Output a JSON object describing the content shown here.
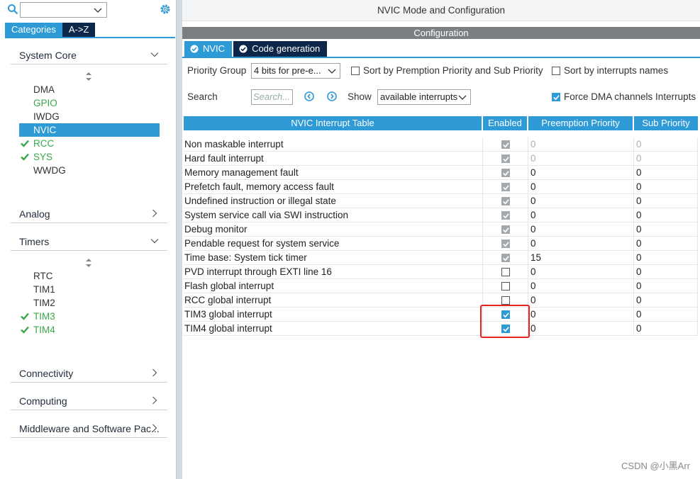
{
  "left_panel": {
    "search_value": "",
    "tabs": [
      {
        "label": "Categories",
        "active": true
      },
      {
        "label": "A->Z",
        "active": false
      }
    ],
    "categories": {
      "system_core": {
        "label": "System Core",
        "items": [
          {
            "label": "DMA",
            "state": "normal"
          },
          {
            "label": "GPIO",
            "state": "green"
          },
          {
            "label": "IWDG",
            "state": "normal"
          },
          {
            "label": "NVIC",
            "state": "selected"
          },
          {
            "label": "RCC",
            "state": "green-check"
          },
          {
            "label": "SYS",
            "state": "green-check"
          },
          {
            "label": "WWDG",
            "state": "normal"
          }
        ]
      },
      "analog": {
        "label": "Analog"
      },
      "timers": {
        "label": "Timers",
        "items": [
          {
            "label": "RTC",
            "state": "normal"
          },
          {
            "label": "TIM1",
            "state": "normal"
          },
          {
            "label": "TIM2",
            "state": "normal"
          },
          {
            "label": "TIM3",
            "state": "green-check"
          },
          {
            "label": "TIM4",
            "state": "green-check"
          }
        ]
      },
      "connectivity": {
        "label": "Connectivity"
      },
      "computing": {
        "label": "Computing"
      },
      "middleware": {
        "label": "Middleware and Software Pac..."
      }
    }
  },
  "right_panel": {
    "title": "NVIC Mode and Configuration",
    "config_label": "Configuration",
    "tabs": [
      {
        "label": "NVIC",
        "active": true
      },
      {
        "label": "Code generation",
        "active": false
      }
    ],
    "priority_group_label": "Priority Group",
    "priority_group_value": "4 bits for pre-e...",
    "sort_premption_label": "Sort by Premption Priority and Sub Priority",
    "sort_names_label": "Sort by interrupts names",
    "search_label": "Search",
    "search_placeholder": "Search...",
    "show_label": "Show",
    "show_value": "available interrupts",
    "force_dma_label": "Force DMA channels Interrupts",
    "table": {
      "headers": [
        "NVIC Interrupt Table",
        "Enabled",
        "Preemption Priority",
        "Sub Priority"
      ],
      "rows": [
        {
          "name": "Non maskable interrupt",
          "enabled": "locked",
          "preemption": "0",
          "sub": "0",
          "faded": true
        },
        {
          "name": "Hard fault interrupt",
          "enabled": "locked",
          "preemption": "0",
          "sub": "0",
          "faded": true
        },
        {
          "name": "Memory management fault",
          "enabled": "locked",
          "preemption": "0",
          "sub": "0",
          "faded": false
        },
        {
          "name": "Prefetch fault, memory access fault",
          "enabled": "locked",
          "preemption": "0",
          "sub": "0",
          "faded": false
        },
        {
          "name": "Undefined instruction or illegal state",
          "enabled": "locked",
          "preemption": "0",
          "sub": "0",
          "faded": false
        },
        {
          "name": "System service call via SWI instruction",
          "enabled": "locked",
          "preemption": "0",
          "sub": "0",
          "faded": false
        },
        {
          "name": "Debug monitor",
          "enabled": "locked",
          "preemption": "0",
          "sub": "0",
          "faded": false
        },
        {
          "name": "Pendable request for system service",
          "enabled": "locked",
          "preemption": "0",
          "sub": "0",
          "faded": false
        },
        {
          "name": "Time base: System tick timer",
          "enabled": "locked",
          "preemption": "15",
          "sub": "0",
          "faded": false
        },
        {
          "name": "PVD interrupt through EXTI line 16",
          "enabled": "off",
          "preemption": "0",
          "sub": "0",
          "faded": false
        },
        {
          "name": "Flash global interrupt",
          "enabled": "off",
          "preemption": "0",
          "sub": "0",
          "faded": false
        },
        {
          "name": "RCC global interrupt",
          "enabled": "off",
          "preemption": "0",
          "sub": "0",
          "faded": false
        },
        {
          "name": "TIM3 global interrupt",
          "enabled": "on",
          "preemption": "0",
          "sub": "0",
          "faded": false
        },
        {
          "name": "TIM4 global interrupt",
          "enabled": "on",
          "preemption": "0",
          "sub": "0",
          "faded": false
        }
      ]
    }
  },
  "watermark": "CSDN @小黑Arr",
  "colors": {
    "accent": "#2e9bd6",
    "navy": "#0c2749",
    "green": "#3aa64a",
    "highlight": "#e6211f"
  }
}
